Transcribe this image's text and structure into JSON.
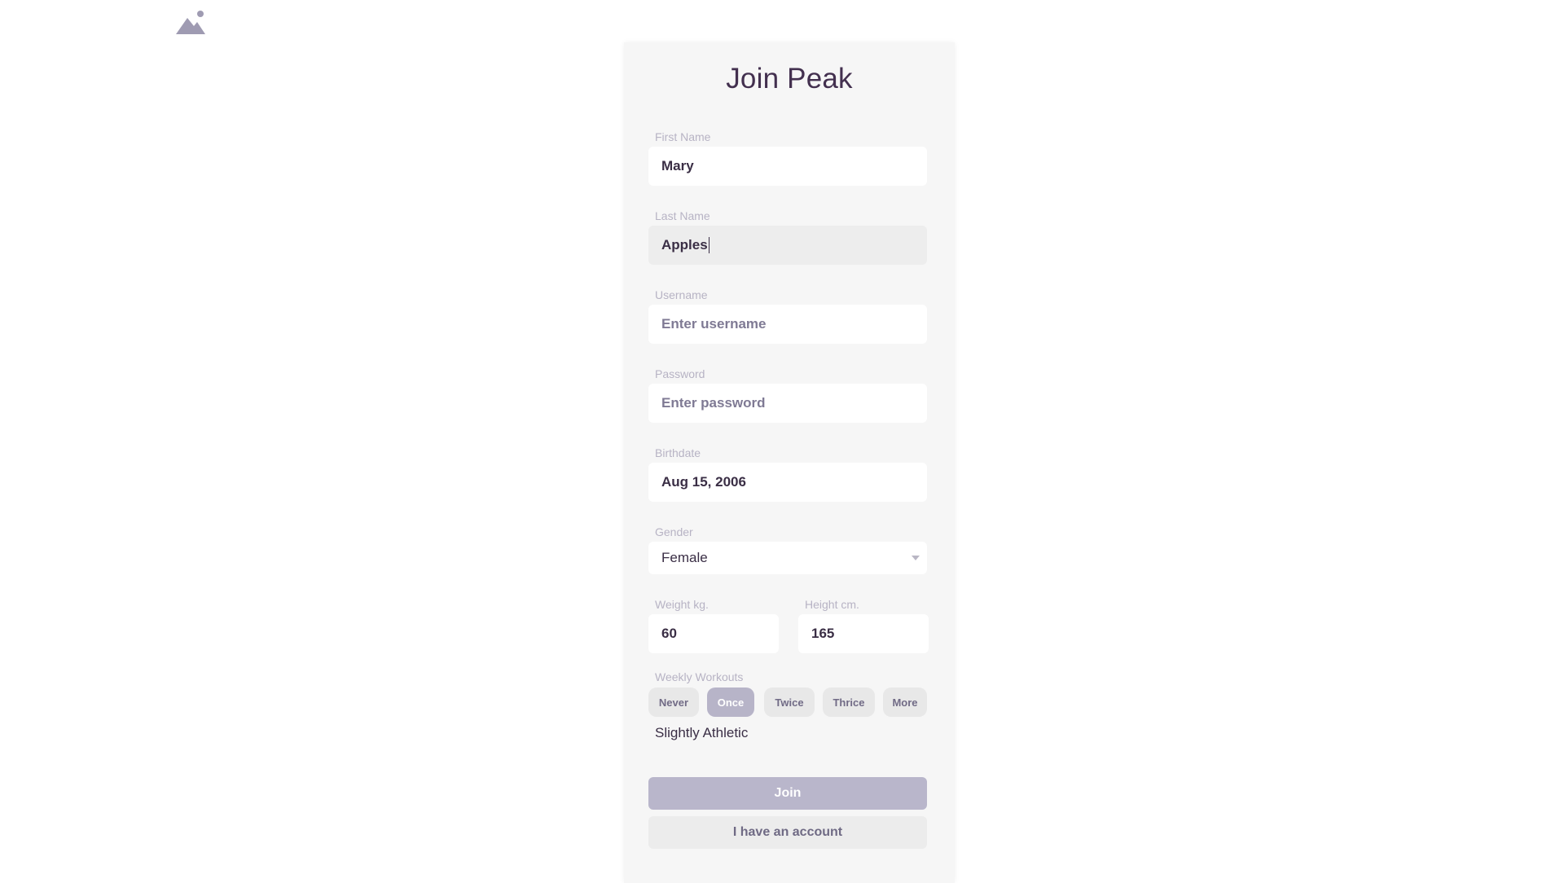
{
  "logo": {
    "icon": "mountain-icon"
  },
  "title": "Join Peak",
  "fields": {
    "first_name": {
      "label": "First Name",
      "value": "Mary"
    },
    "last_name": {
      "label": "Last Name",
      "value": "Apples"
    },
    "username": {
      "label": "Username",
      "placeholder": "Enter username"
    },
    "password": {
      "label": "Password",
      "placeholder": "Enter password"
    },
    "birthdate": {
      "label": "Birthdate",
      "value": "Aug 15, 2006"
    },
    "gender": {
      "label": "Gender",
      "value": "Female"
    },
    "weight": {
      "label": "Weight kg.",
      "value": "60"
    },
    "height": {
      "label": "Height cm.",
      "value": "165"
    }
  },
  "workouts": {
    "label": "Weekly Workouts",
    "options": [
      "Never",
      "Once",
      "Twice",
      "Thrice",
      "More"
    ],
    "selected": "Once",
    "level_text": "Slightly Athletic"
  },
  "buttons": {
    "join": "Join",
    "have_account": "I have an account"
  },
  "colors": {
    "accent": "#b9b6cb",
    "text": "#43304f",
    "label": "#b7b3c4"
  }
}
